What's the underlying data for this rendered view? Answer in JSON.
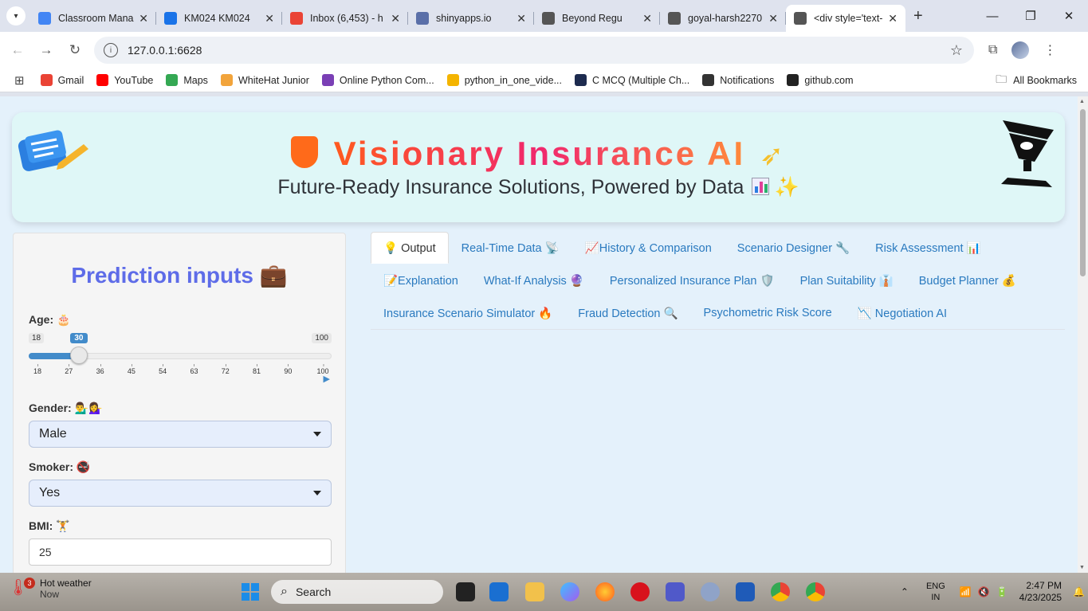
{
  "browser": {
    "tabs": [
      {
        "title": "Classroom Mana",
        "favicon": "google-icon",
        "color": "#4285f4"
      },
      {
        "title": "KM024 KM024",
        "favicon": "contacts-icon",
        "color": "#1a73e8"
      },
      {
        "title": "Inbox (6,453) - h",
        "favicon": "gmail-icon",
        "color": "#ea4335"
      },
      {
        "title": "shinyapps.io",
        "favicon": "shinyapps-icon",
        "color": "#5a6fa8"
      },
      {
        "title": "Beyond Regu",
        "favicon": "globe-icon",
        "color": "#555555"
      },
      {
        "title": "goyal-harsh2270",
        "favicon": "globe-icon",
        "color": "#555555"
      },
      {
        "title": "<div style='text-",
        "favicon": "globe-icon",
        "color": "#555555"
      }
    ],
    "url": "127.0.0.1:6628",
    "bookmarks": [
      {
        "label": "Gmail",
        "icon": "gmail-icon",
        "color": "#ea4335"
      },
      {
        "label": "YouTube",
        "icon": "youtube-icon",
        "color": "#ff0000"
      },
      {
        "label": "Maps",
        "icon": "maps-icon",
        "color": "#34a853"
      },
      {
        "label": "WhiteHat Junior",
        "icon": "whitehat-icon",
        "color": "#f2a43b"
      },
      {
        "label": "Online Python Com...",
        "icon": "python-icon",
        "color": "#7a3fb5"
      },
      {
        "label": "python_in_one_vide...",
        "icon": "slides-icon",
        "color": "#f4b400"
      },
      {
        "label": "C MCQ (Multiple Ch...",
        "icon": "sanfoundry-icon",
        "color": "#1d2b4f"
      },
      {
        "label": "Notifications",
        "icon": "globe-icon",
        "color": "#333333"
      },
      {
        "label": "github.com",
        "icon": "github-icon",
        "color": "#222222"
      }
    ],
    "all_bookmarks": "All Bookmarks"
  },
  "banner": {
    "title": "Visionary Insurance AI",
    "subtitle": "Future-Ready Insurance Solutions, Powered by Data"
  },
  "sidebar": {
    "title": "Prediction inputs",
    "title_icon": "briefcase-icon",
    "age": {
      "label": "Age:",
      "min": 18,
      "max": 100,
      "value": 30,
      "min_label": "18",
      "max_label": "100",
      "value_label": "30",
      "ticks": [
        "18",
        "27",
        "36",
        "45",
        "54",
        "63",
        "72",
        "81",
        "90",
        "100"
      ]
    },
    "gender": {
      "label": "Gender:",
      "value": "Male"
    },
    "smoker": {
      "label": "Smoker:",
      "value": "Yes"
    },
    "bmi": {
      "label": "BMI:",
      "value": "25"
    }
  },
  "tabs": {
    "row1": [
      {
        "label": "💡 Output",
        "active": true
      },
      {
        "label": "Real-Time Data 📡"
      },
      {
        "label": "📈History & Comparison"
      },
      {
        "label": "Scenario Designer 🔧"
      },
      {
        "label": "Risk Assessment 📊"
      }
    ],
    "row2": [
      {
        "label": "📝Explanation"
      },
      {
        "label": "What-If Analysis 🔮"
      },
      {
        "label": "Personalized Insurance Plan 🛡️"
      },
      {
        "label": "Plan Suitability 👔"
      },
      {
        "label": "Budget Planner 💰"
      }
    ],
    "row3": [
      {
        "label": "Insurance Scenario Simulator 🔥"
      },
      {
        "label": "Fraud Detection 🔍"
      },
      {
        "label": "Psychometric Risk Score"
      },
      {
        "label": "📉 Negotiation AI"
      }
    ]
  },
  "taskbar": {
    "weather_title": "Hot weather",
    "weather_sub": "Now",
    "weather_badge": "3",
    "search_placeholder": "Search",
    "lang_top": "ENG",
    "lang_bottom": "IN",
    "time": "2:47 PM",
    "date": "4/23/2025"
  }
}
